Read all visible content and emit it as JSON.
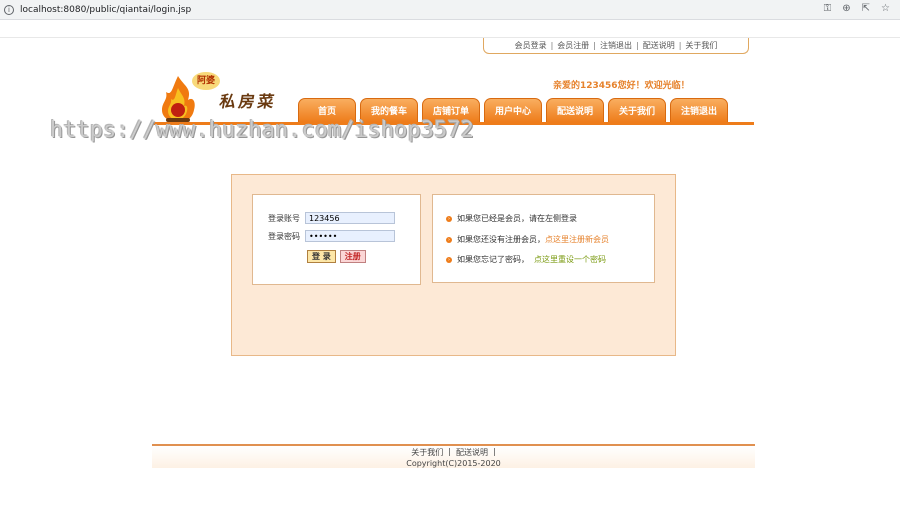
{
  "browser": {
    "url": "localhost:8080/public/qiantai/login.jsp",
    "icons": [
      "key-icon",
      "zoom-icon",
      "share-icon",
      "star-icon"
    ]
  },
  "top_links": {
    "member_login": "会员登录",
    "member_register": "会员注册",
    "logout": "注销退出",
    "delivery_info": "配送说明",
    "about_us": "关于我们",
    "separator": "|"
  },
  "logo": {
    "badge": "阿婆",
    "text": "私房菜"
  },
  "welcome": "亲爱的123456您好！欢迎光临！",
  "nav": {
    "items": [
      "首页",
      "我的餐车",
      "店铺订单",
      "用户中心",
      "配送说明",
      "关于我们",
      "注销退出"
    ]
  },
  "watermark": "https://www.huzhan.com/ishop3572",
  "login": {
    "account_label": "登录账号",
    "account_value": "123456",
    "password_label": "登录密码",
    "password_value": "••••••",
    "login_button": "登 录",
    "register_button": "注册"
  },
  "info": {
    "line1": "如果您已经是会员，请在左侧登录",
    "line2_prefix": "如果您还没有注册会员，",
    "line2_link": "点这里注册新会员",
    "line3_prefix": "如果您忘记了密码，",
    "line3_link": "点这里重设一个密码"
  },
  "footer": {
    "about_us": "关于我们",
    "delivery_info": "配送说明",
    "separator": "|",
    "copyright": "Copyright(C)2015-2020"
  },
  "colors": {
    "accent": "#ee7c1a",
    "panel_bg": "#fde9d6",
    "welcome": "#e6822c"
  }
}
